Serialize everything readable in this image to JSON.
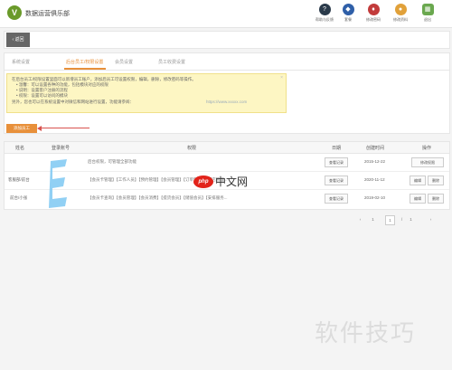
{
  "app": {
    "logo_letter": "V",
    "brand": "数据运营俱乐部"
  },
  "toolbar": [
    {
      "icon": "question-icon",
      "glyph": "?",
      "color": "#2a3a4a",
      "label": "帮助与反馈"
    },
    {
      "icon": "diamond-icon",
      "glyph": "◆",
      "color": "#2f5fa8",
      "label": "套餐"
    },
    {
      "icon": "shield-icon",
      "glyph": "♦",
      "color": "#c23b3b",
      "label": "修改密码"
    },
    {
      "icon": "user-icon",
      "glyph": "●",
      "color": "#e1a13a",
      "label": "修改资料"
    },
    {
      "icon": "grid-icon",
      "glyph": "▦",
      "color": "#6aa84f",
      "label": "退出"
    }
  ],
  "back": {
    "label": "返回"
  },
  "tabs": [
    "系统设置",
    "后台员工/权限设置",
    "会员设置",
    "员工收费设置"
  ],
  "notice": {
    "lines": [
      "在后台员工/权限设置里面可以新增员工账户，添加后员工可设置权限，编辑，删除，修改密码等操作。",
      "• 温馨：可以设置各种的功能，包括模块对应的权限",
      "• 说明：设置客户注册的流程",
      "• 权限：设置可以访问的模块",
      "另外，您也可以在系统设置中对微信和网站进行设置，功能请参阅：",
      "https://www.xxxxx.com"
    ],
    "close": "×"
  },
  "add_button": "添加员工",
  "table": {
    "headers": [
      "姓名",
      "登录账号",
      "权限",
      "日期",
      "创建时间",
      "操作"
    ],
    "rows": [
      {
        "name": "",
        "account": "",
        "perm": "后台权限，可管理全部功能",
        "view": "查看记录",
        "date": "2015-12-22",
        "actions": [
          "修改权限"
        ]
      },
      {
        "name": "客服部/前台",
        "account": "",
        "perm": "【会员卡管理】【工作人员】【预约管理】【会员管理】【订单管理】【门店管理...",
        "view": "查看记录",
        "date": "2020-11-12",
        "actions": [
          "编辑",
          "删除"
        ]
      },
      {
        "name": "前台/小张",
        "account": "",
        "perm": "【会员卡查询】【会员管理】【会员消费】【提货会员】【储值会员】【安排服务...",
        "view": "查看记录",
        "date": "2019-02-10",
        "actions": [
          "编辑",
          "删除"
        ]
      }
    ]
  },
  "pager": {
    "prev": "‹",
    "first": "1",
    "current": "1",
    "sep": "/",
    "total": "1",
    "next": "›"
  },
  "watermarks": {
    "php_badge": "php",
    "php_text": "中文网",
    "site": "软件技巧"
  }
}
